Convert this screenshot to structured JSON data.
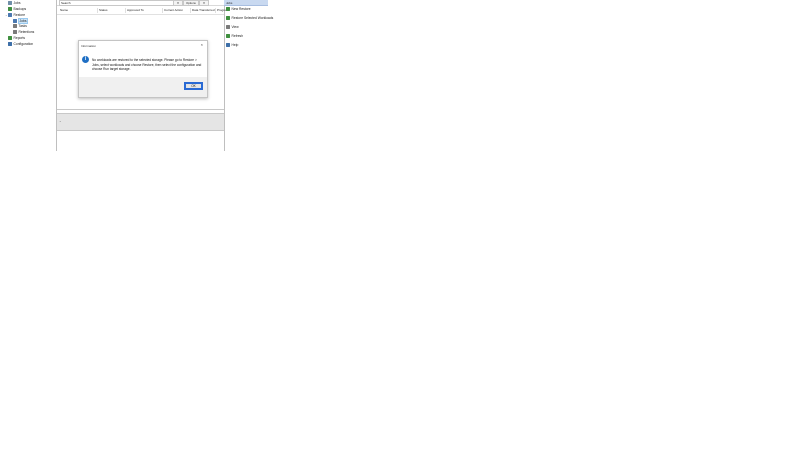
{
  "tree": {
    "items": [
      {
        "label": "Jobs",
        "icon": "folder-icon",
        "color": "#6f8ea8",
        "indent": 0,
        "chevron": ""
      },
      {
        "label": "Backups",
        "icon": "backup-icon",
        "color": "#3f8f3f",
        "indent": 0,
        "chevron": ""
      },
      {
        "label": "Restore",
        "icon": "restore-icon",
        "color": "#4a78b0",
        "indent": 0,
        "chevron": "⌄"
      },
      {
        "label": "Jobs",
        "icon": "jobs-icon",
        "color": "#4a78b0",
        "indent": 1,
        "chevron": "",
        "selected": true
      },
      {
        "label": "Tasks",
        "icon": "tasks-icon",
        "color": "#7a7a7a",
        "indent": 1,
        "chevron": ""
      },
      {
        "label": "Retentions",
        "icon": "retention-icon",
        "color": "#7a7a7a",
        "indent": 1,
        "chevron": ""
      },
      {
        "label": "Reports",
        "icon": "reports-icon",
        "color": "#3f8f3f",
        "indent": 0,
        "chevron": ""
      },
      {
        "label": "Configuration",
        "icon": "config-icon",
        "color": "#3d6fa8",
        "indent": 0,
        "chevron": ""
      }
    ]
  },
  "center": {
    "filter_value": "Search",
    "filter_options_label": "Options",
    "dropdown_glyph": "▾",
    "columns": [
      "Name",
      "Status",
      "Approved To",
      "Current Action",
      "Data Transferred",
      "Progress"
    ],
    "details_chevron": "⌄"
  },
  "dialog": {
    "title": "Information",
    "close_glyph": "×",
    "info_glyph": "i",
    "message": "No workloads are restored to the selected storage. Please go to Restore > Jobs, select workloads and choose Restore, then select the configuration and choose Run target storage.",
    "ok_label": "OK"
  },
  "actions": {
    "header": "Jobs",
    "items": [
      {
        "label": "New Restore",
        "icon": "new-restore-icon",
        "color": "#3f8f3f"
      },
      {
        "label": "Restore Selected Workloads",
        "icon": "restore-selected-icon",
        "color": "#3f8f3f"
      },
      {
        "label": "View",
        "icon": "view-icon",
        "color": "#7a7a7a"
      },
      {
        "label": "Refresh",
        "icon": "refresh-icon",
        "color": "#3f8f3f"
      },
      {
        "label": "Help",
        "icon": "help-icon",
        "color": "#3d6fa8"
      }
    ]
  },
  "colors": {
    "accent": "#1f6fc4",
    "selection": "#cce4f7",
    "actions_header": "#c9d9f0",
    "details_band": "#e5e5e5"
  }
}
